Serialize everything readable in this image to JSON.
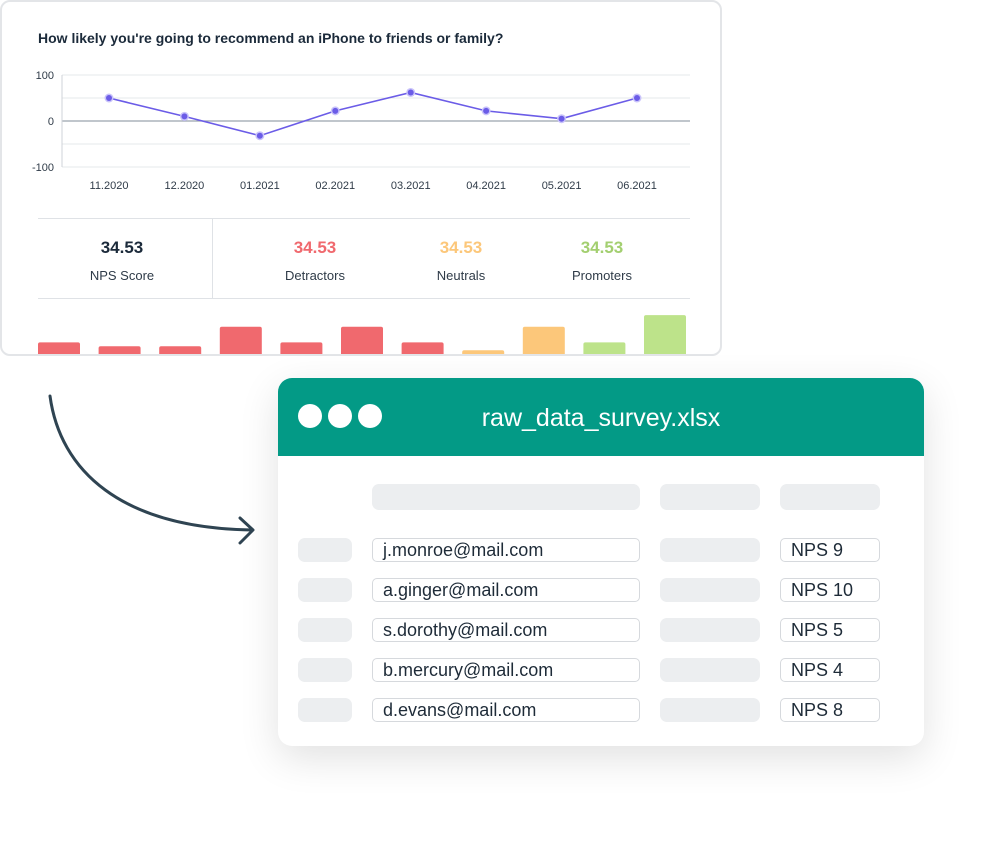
{
  "card": {
    "question": "How likely you're going to recommend an iPhone to friends or family?"
  },
  "chart_data": [
    {
      "type": "line",
      "x": [
        "11.2020",
        "12.2020",
        "01.2021",
        "02.2021",
        "03.2021",
        "04.2021",
        "05.2021",
        "06.2021"
      ],
      "series": [
        {
          "values": [
            50,
            10,
            -32,
            22,
            62,
            22,
            5,
            50
          ]
        }
      ],
      "ylim": [
        -100,
        100
      ],
      "yticks": [
        100,
        0,
        -100
      ],
      "grid": true,
      "color": "#6b5ce7"
    },
    {
      "type": "bar",
      "values": [
        4,
        3,
        3,
        8,
        4,
        8,
        4,
        2,
        8,
        4,
        11
      ],
      "colors": [
        "#f0696e",
        "#f0696e",
        "#f0696e",
        "#f0696e",
        "#f0696e",
        "#f0696e",
        "#f0696e",
        "#fcc77a",
        "#fcc77a",
        "#bde38a",
        "#bde38a"
      ]
    }
  ],
  "stats": {
    "nps": {
      "value": "34.53",
      "label": "NPS Score",
      "color": "#1b2a3a"
    },
    "detractors": {
      "value": "34.53",
      "label": "Detractors",
      "color": "#f0696e"
    },
    "neutrals": {
      "value": "34.53",
      "label": "Neutrals",
      "color": "#fcc77a"
    },
    "promoters": {
      "value": "34.53",
      "label": "Promoters",
      "color": "#a3cf70"
    }
  },
  "file": {
    "title": "raw_data_survey.xlsx",
    "header_color": "#039a86",
    "rows": [
      {
        "email": "j.monroe@mail.com",
        "nps": "NPS 9"
      },
      {
        "email": "a.ginger@mail.com",
        "nps": "NPS 10"
      },
      {
        "email": "s.dorothy@mail.com",
        "nps": "NPS 5"
      },
      {
        "email": "b.mercury@mail.com",
        "nps": "NPS 4"
      },
      {
        "email": "d.evans@mail.com",
        "nps": "NPS 8"
      }
    ]
  }
}
